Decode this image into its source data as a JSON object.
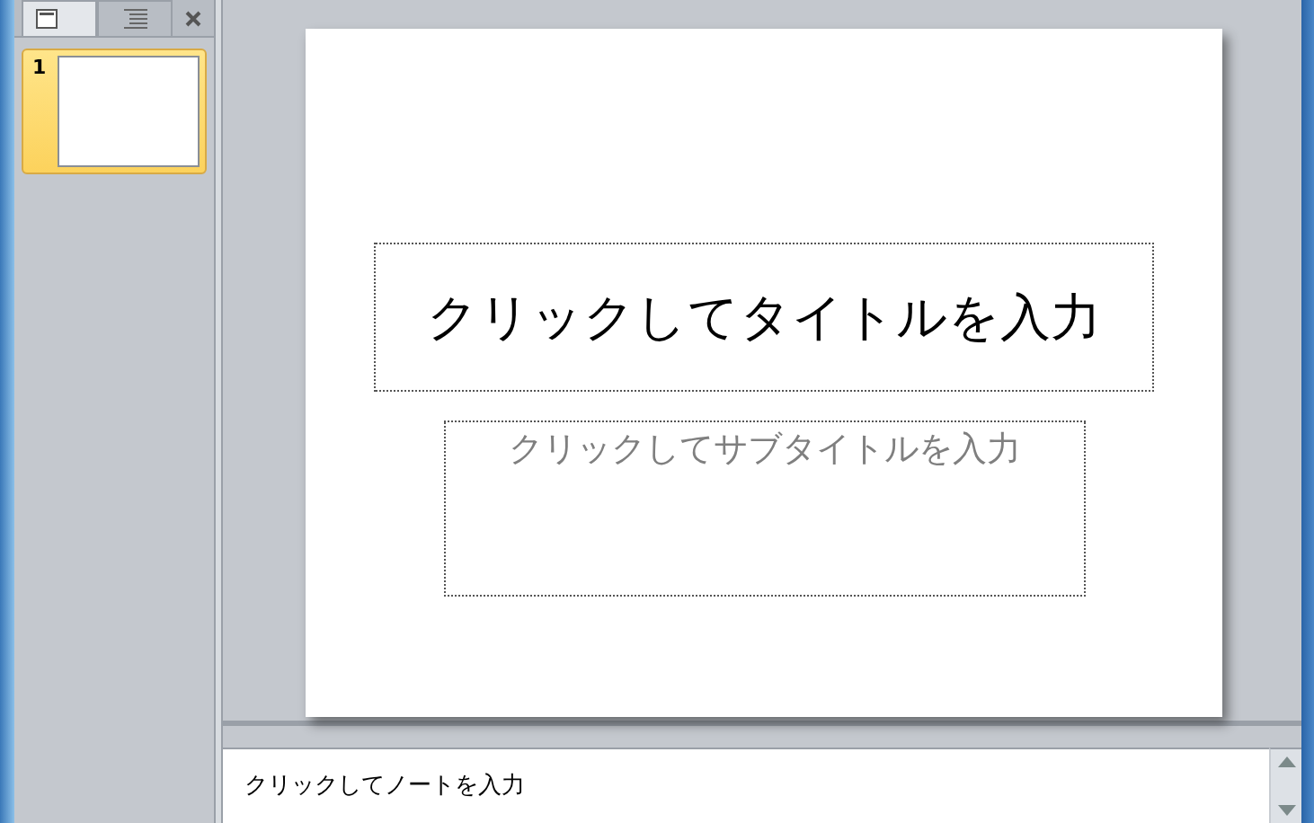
{
  "panel_tabs": [
    {
      "kind": "slides",
      "selected": true
    },
    {
      "kind": "outline",
      "selected": false
    }
  ],
  "thumbnails": [
    {
      "number": "1",
      "selected": true
    }
  ],
  "slide": {
    "title": "クリックしてタイトルを入力",
    "subtitle": "クリックしてサブタイトルを入力"
  },
  "notes": {
    "placeholder": "クリックしてノートを入力"
  }
}
